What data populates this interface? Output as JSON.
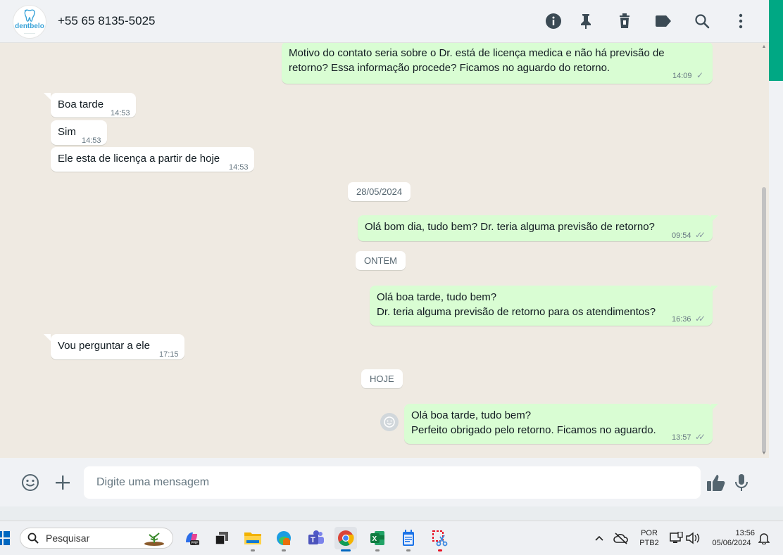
{
  "header": {
    "avatar_brand": "dentbelo",
    "contact": "+55 65 8135-5025",
    "icons": [
      "info-icon",
      "pin-icon",
      "delete-icon",
      "label-icon",
      "search-icon",
      "menu-icon"
    ]
  },
  "messages": [
    {
      "dir": "out",
      "lines": [
        "Motivo do contato seria sobre o Dr. está de licença medica e não há previsão de",
        "retorno? Essa informação procede? Ficamos no aguardo do retorno."
      ],
      "time": "14:09",
      "ticks": "✓"
    },
    {
      "dir": "in",
      "lines": [
        "Boa tarde"
      ],
      "time": "14:53"
    },
    {
      "dir": "in",
      "lines": [
        "Sim"
      ],
      "time": "14:53"
    },
    {
      "dir": "in",
      "lines": [
        "Ele esta de licença a partir de hoje"
      ],
      "time": "14:53"
    },
    {
      "dir": "out",
      "lines": [
        "Olá bom dia, tudo bem? Dr. teria alguma previsão de retorno?"
      ],
      "time": "09:54",
      "ticks": "✓✓"
    },
    {
      "dir": "out",
      "lines": [
        "Olá boa tarde, tudo bem?",
        "Dr. teria alguma previsão de retorno para os atendimentos?"
      ],
      "time": "16:36",
      "ticks": "✓✓"
    },
    {
      "dir": "in",
      "lines": [
        "Vou perguntar a ele"
      ],
      "time": "17:15"
    },
    {
      "dir": "out",
      "lines": [
        "Olá boa tarde, tudo bem?",
        "Perfeito obrigado pelo retorno. Ficamos no aguardo."
      ],
      "time": "13:57",
      "ticks": "✓✓"
    }
  ],
  "dates": [
    "28/05/2024",
    "ONTEM",
    "HOJE"
  ],
  "footer": {
    "placeholder": "Digite uma mensagem"
  },
  "taskbar": {
    "search_label": "Pesquisar",
    "lang_top": "POR",
    "lang_bottom": "PTB2",
    "time": "13:56",
    "date": "05/06/2024"
  },
  "colors": {
    "outgoing": "#d9fdd3",
    "incoming": "#ffffff",
    "accent": "#00a884"
  }
}
